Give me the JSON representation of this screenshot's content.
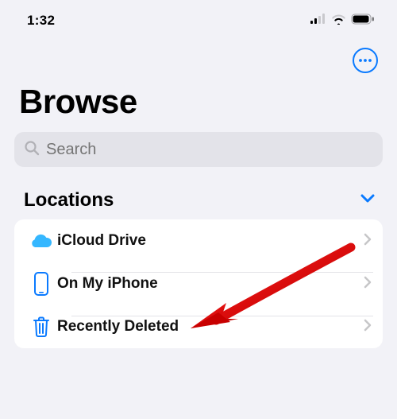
{
  "status": {
    "time": "1:32"
  },
  "title": "Browse",
  "search": {
    "placeholder": "Search"
  },
  "section": {
    "title": "Locations"
  },
  "locations": {
    "items": [
      {
        "label": "iCloud Drive"
      },
      {
        "label": "On My iPhone"
      },
      {
        "label": "Recently Deleted"
      }
    ]
  },
  "colors": {
    "accent": "#0a7aff"
  }
}
